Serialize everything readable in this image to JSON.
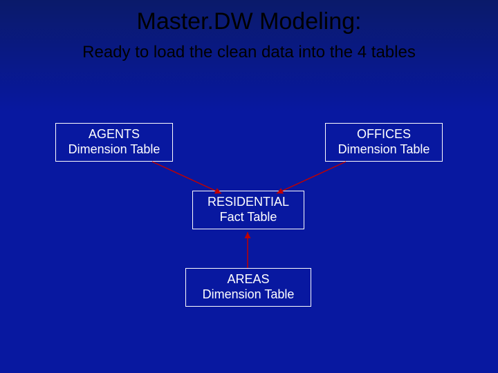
{
  "title": "Master.DW Modeling:",
  "subtitle": "Ready to load the clean data into the 4 tables",
  "boxes": {
    "agents": "AGENTS\nDimension Table",
    "offices": "OFFICES\nDimension Table",
    "fact": "RESIDENTIAL\nFact Table",
    "areas": "AREAS\nDimension Table"
  },
  "colors": {
    "arrow": "#c00000",
    "box_border": "#ffffff",
    "text_light": "#ffffff",
    "text_dark": "#000000"
  }
}
